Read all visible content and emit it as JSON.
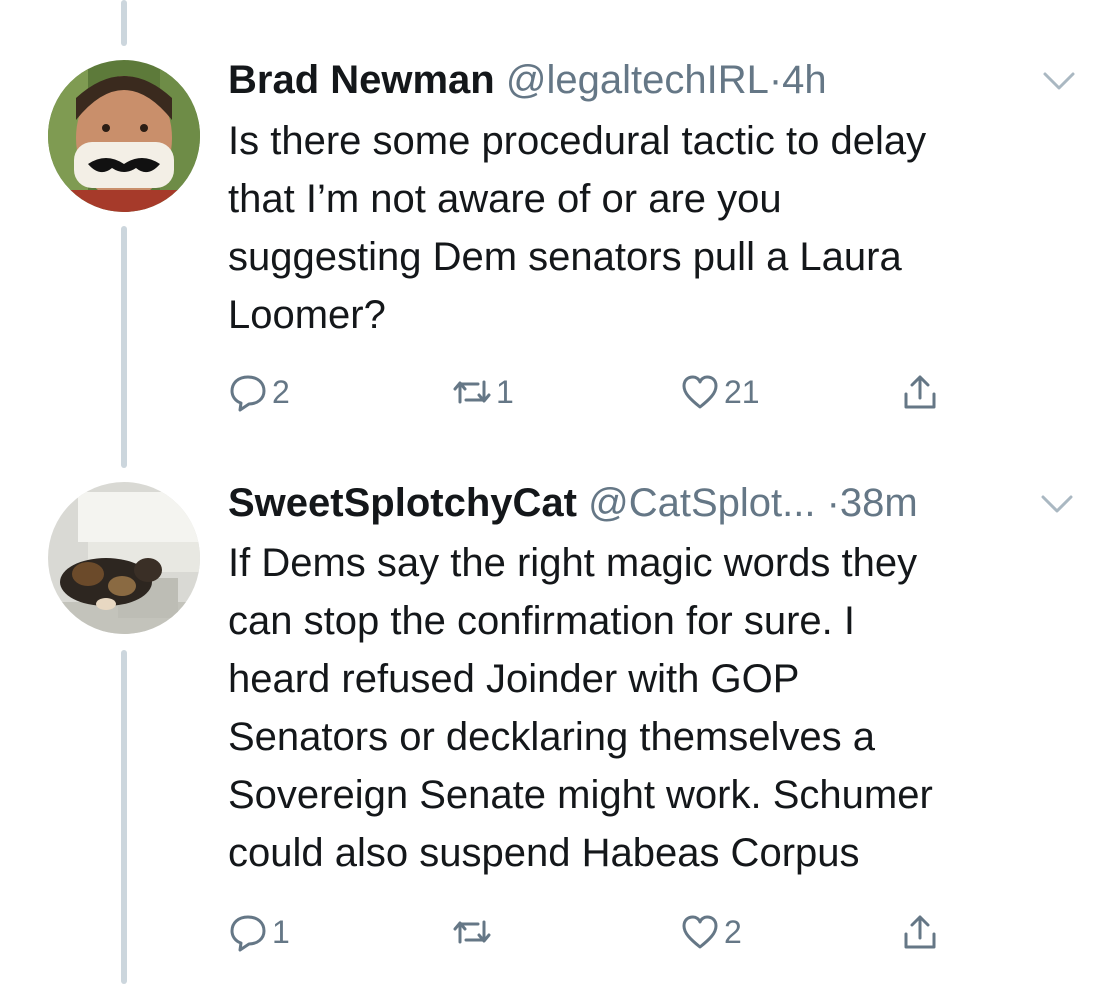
{
  "tweets": [
    {
      "display_name": "Brad Newman",
      "handle": "@legaltechIRL",
      "separator": "·",
      "time": "4h",
      "text": "Is there some procedural tactic to delay\nthat I’m not aware of or are you\nsuggesting Dem senators pull a Laura\nLoomer?",
      "replies": "2",
      "retweets": "1",
      "likes": "21",
      "icons": {
        "reply": "reply-icon",
        "retweet": "retweet-icon",
        "like": "heart-icon",
        "share": "share-icon",
        "menu": "chevron-down-icon"
      }
    },
    {
      "display_name": "SweetSplotchyCat",
      "handle": "@CatSplot...",
      "separator": "·",
      "time": "38m",
      "text": "If Dems say the right magic words they\ncan stop the confirmation for sure. I\nheard refused Joinder with GOP\nSenators or decklaring themselves a\nSovereign Senate might work. Schumer\ncould also suspend Habeas Corpus",
      "replies": "1",
      "retweets": "",
      "likes": "2",
      "icons": {
        "reply": "reply-icon",
        "retweet": "retweet-icon",
        "like": "heart-icon",
        "share": "share-icon",
        "menu": "chevron-down-icon"
      }
    }
  ],
  "colors": {
    "text": "#14171a",
    "secondary": "#657786",
    "thread_line": "#ccd6dd"
  }
}
